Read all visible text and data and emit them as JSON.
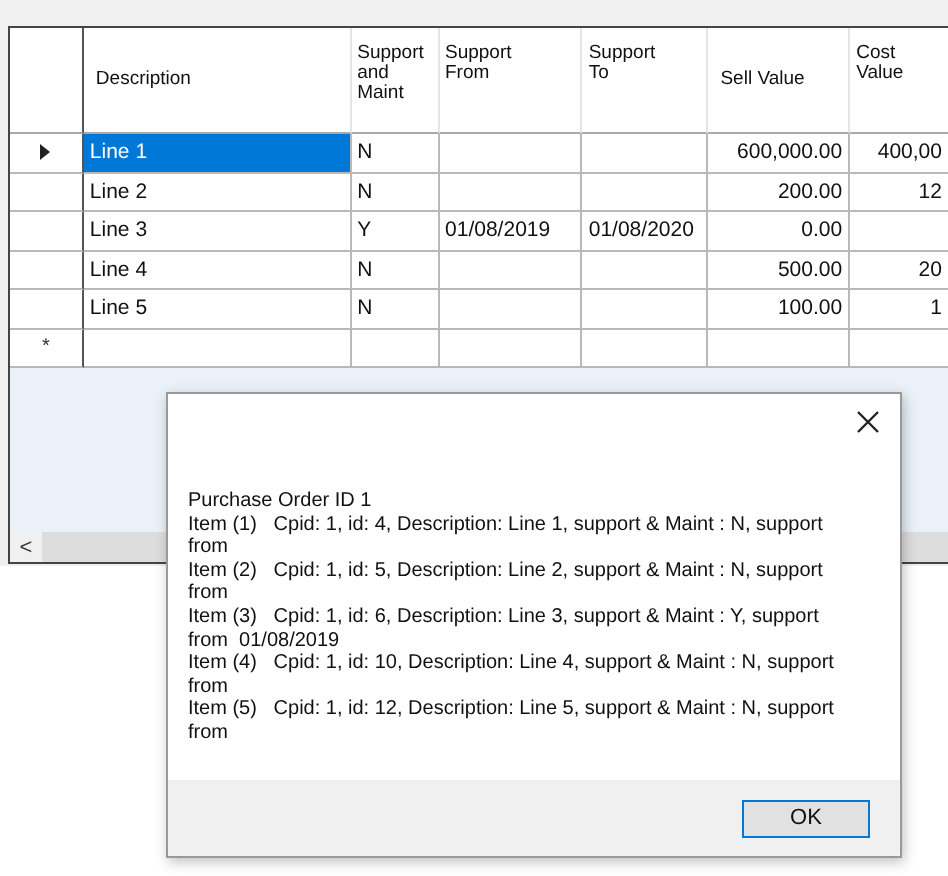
{
  "grid": {
    "columns": [
      "Description",
      "Support and Maint",
      "Support From",
      "Support To",
      "Sell Value",
      "Cost Value"
    ],
    "rows": [
      {
        "current": true,
        "selected": true,
        "cells": [
          "Line 1",
          "N",
          "",
          "",
          "600,000.00",
          "400,00"
        ]
      },
      {
        "current": false,
        "selected": false,
        "cells": [
          "Line 2",
          "N",
          "",
          "",
          "200.00",
          "12"
        ]
      },
      {
        "current": false,
        "selected": false,
        "cells": [
          "Line 3",
          "Y",
          "01/08/2019",
          "01/08/2020",
          "0.00",
          ""
        ]
      },
      {
        "current": false,
        "selected": false,
        "cells": [
          "Line 4",
          "N",
          "",
          "",
          "500.00",
          "20"
        ]
      },
      {
        "current": false,
        "selected": false,
        "cells": [
          "Line 5",
          "N",
          "",
          "",
          "100.00",
          "1"
        ]
      }
    ],
    "new_row_marker": "*",
    "scroll_left": "<"
  },
  "dialog": {
    "lines": [
      "Purchase Order ID 1",
      "Item (1)   Cpid: 1, id: 4, Description: Line 1, support & Maint : N, support from",
      "Item (2)   Cpid: 1, id: 5, Description: Line 2, support & Maint : N, support from",
      "Item (3)   Cpid: 1, id: 6, Description: Line 3, support & Maint : Y, support from  01/08/2019",
      "Item (4)   Cpid: 1, id: 10, Description: Line 4, support & Maint : N, support from",
      "Item (5)   Cpid: 1, id: 12, Description: Line 5, support & Maint : N, support from"
    ],
    "button": "OK"
  }
}
